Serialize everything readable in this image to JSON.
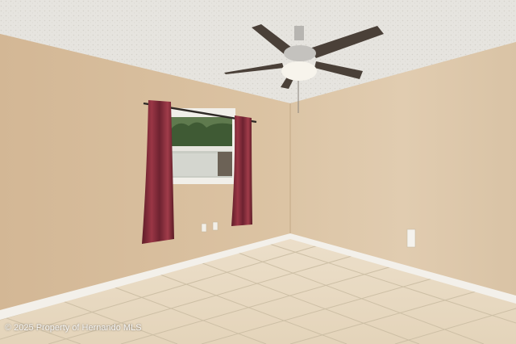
{
  "photo": {
    "watermark": "© 2025 Property of Hernando MLS"
  },
  "colors": {
    "ceiling": "#e6e4df",
    "left_wall": "#d8bf9f",
    "back_wall": "#dcc5a6",
    "right_wall": "#dcc7aa",
    "baseboard": "#f3f0ea",
    "floor_tile": "#e9dcc5",
    "grout": "#cdbfa5",
    "curtain": "#8a2d3a",
    "fan_blade": "#4a4038",
    "fan_metal": "#b7b5b1"
  },
  "icons": [
    "ceiling-fan-icon",
    "window-icon",
    "curtain-icon",
    "outlet-icon"
  ]
}
